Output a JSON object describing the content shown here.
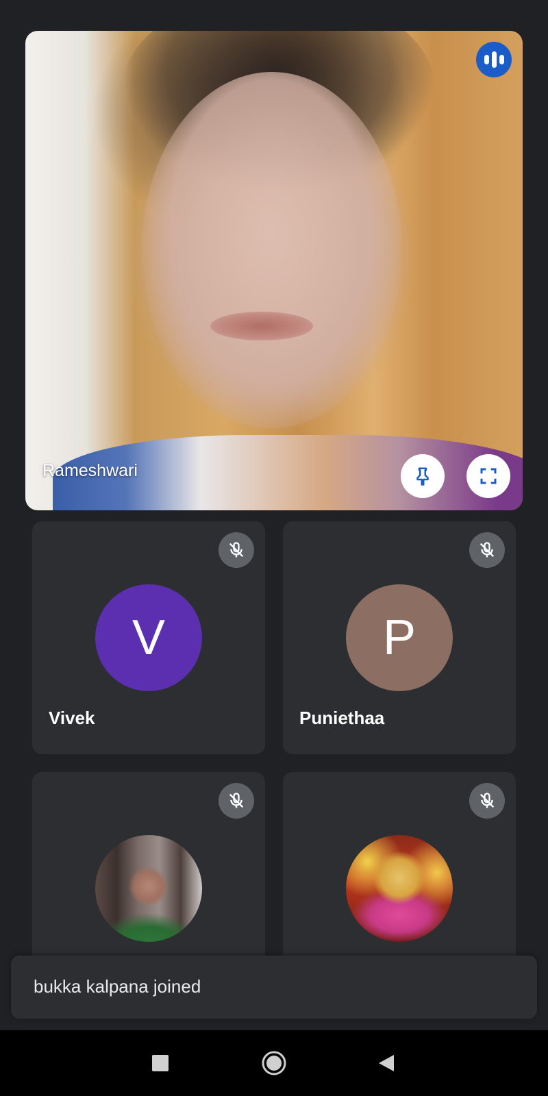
{
  "main_participant": {
    "name": "Rameshwari",
    "speaking": true,
    "accent_color": "#1a5cc8",
    "icons": {
      "speaking": "audio-level-icon",
      "pin": "pin-icon",
      "fullscreen": "fullscreen-icon"
    }
  },
  "participants": [
    {
      "name": "Vivek",
      "initial": "V",
      "avatar_color": "#5b2fb0",
      "muted": true,
      "avatar_type": "letter"
    },
    {
      "name": "Puniethaa",
      "initial": "P",
      "avatar_color": "#8d6e63",
      "muted": true,
      "avatar_type": "letter"
    },
    {
      "name": "",
      "muted": true,
      "avatar_type": "photo"
    },
    {
      "name": "",
      "muted": true,
      "avatar_type": "photo"
    }
  ],
  "toast": {
    "message": "bukka kalpana joined"
  },
  "navigation": {
    "icons": [
      "recents-icon",
      "home-icon",
      "back-icon"
    ]
  }
}
